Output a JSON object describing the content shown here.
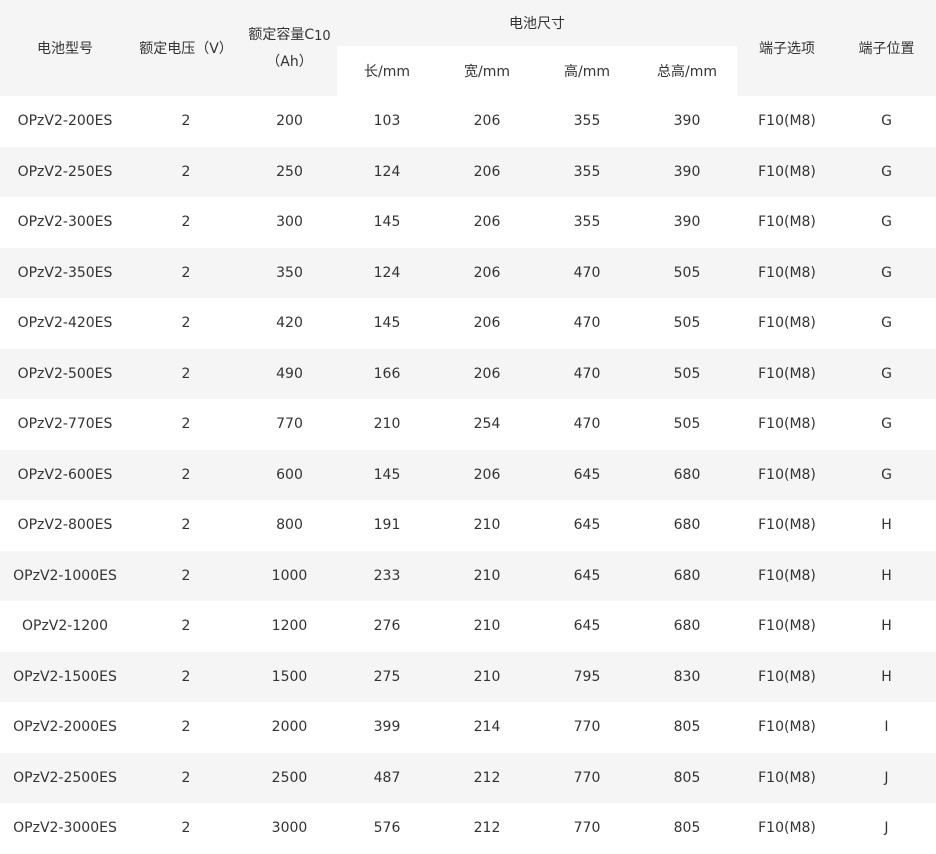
{
  "table": {
    "headers": {
      "model": "电池型号",
      "voltage": "额定电压（V）",
      "capacity_line1": "额定容量C",
      "capacity_sub": "10",
      "capacity_line2": "（Ah）",
      "dimensions": "电池尺寸",
      "length": "长/mm",
      "width": "宽/mm",
      "height": "高/mm",
      "total_height": "总高/mm",
      "terminal_option": "端子选项",
      "terminal_position": "端子位置"
    },
    "rows": [
      [
        "OPzV2-200ES",
        "2",
        "200",
        "103",
        "206",
        "355",
        "390",
        "F10(M8)",
        "G"
      ],
      [
        "OPzV2-250ES",
        "2",
        "250",
        "124",
        "206",
        "355",
        "390",
        "F10(M8)",
        "G"
      ],
      [
        "OPzV2-300ES",
        "2",
        "300",
        "145",
        "206",
        "355",
        "390",
        "F10(M8)",
        "G"
      ],
      [
        "OPzV2-350ES",
        "2",
        "350",
        "124",
        "206",
        "470",
        "505",
        "F10(M8)",
        "G"
      ],
      [
        "OPzV2-420ES",
        "2",
        "420",
        "145",
        "206",
        "470",
        "505",
        "F10(M8)",
        "G"
      ],
      [
        "OPzV2-500ES",
        "2",
        "490",
        "166",
        "206",
        "470",
        "505",
        "F10(M8)",
        "G"
      ],
      [
        "OPzV2-770ES",
        "2",
        "770",
        "210",
        "254",
        "470",
        "505",
        "F10(M8)",
        "G"
      ],
      [
        "OPzV2-600ES",
        "2",
        "600",
        "145",
        "206",
        "645",
        "680",
        "F10(M8)",
        "G"
      ],
      [
        "OPzV2-800ES",
        "2",
        "800",
        "191",
        "210",
        "645",
        "680",
        "F10(M8)",
        "H"
      ],
      [
        "OPzV2-1000ES",
        "2",
        "1000",
        "233",
        "210",
        "645",
        "680",
        "F10(M8)",
        "H"
      ],
      [
        "OPzV2-1200",
        "2",
        "1200",
        "276",
        "210",
        "645",
        "680",
        "F10(M8)",
        "H"
      ],
      [
        "OPzV2-1500ES",
        "2",
        "1500",
        "275",
        "210",
        "795",
        "830",
        "F10(M8)",
        "H"
      ],
      [
        "OPzV2-2000ES",
        "2",
        "2000",
        "399",
        "214",
        "770",
        "805",
        "F10(M8)",
        "I"
      ],
      [
        "OPzV2-2500ES",
        "2",
        "2500",
        "487",
        "212",
        "770",
        "805",
        "F10(M8)",
        "J"
      ],
      [
        "OPzV2-3000ES",
        "2",
        "3000",
        "576",
        "212",
        "770",
        "805",
        "F10(M8)",
        "J"
      ]
    ]
  },
  "colors": {
    "header_bg": "#f5f5f5",
    "row_alt_bg": "#f5f5f5",
    "text": "#333333"
  }
}
